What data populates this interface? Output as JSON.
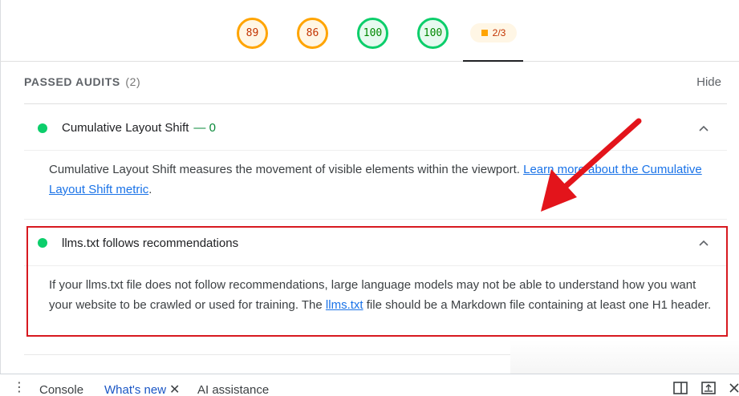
{
  "scores": {
    "performance": "89",
    "accessibility": "86",
    "best_practices": "100",
    "seo": "100",
    "pwa": "2/3"
  },
  "section": {
    "title": "PASSED AUDITS",
    "count": "(2)",
    "hide_label": "Hide"
  },
  "audits": [
    {
      "title": "Cumulative Layout Shift",
      "value": "— 0",
      "description": "Cumulative Layout Shift measures the movement of visible elements within the viewport. ",
      "link_text": "Learn more about the Cumulative Layout Shift metric",
      "description_end": "."
    },
    {
      "title": "llms.txt follows recommendations",
      "description": "If your llms.txt file does not follow recommendations, large language models may not be able to understand how you want your website to be crawled or used for training. The ",
      "link_text": "llms.txt",
      "description_end": " file should be a Markdown file containing at least one H1 header."
    }
  ],
  "drawer": {
    "tabs": [
      "Console",
      "What's new",
      "AI assistance"
    ],
    "active_tab": "What's new"
  },
  "colors": {
    "average": "#ffa400",
    "pass": "#0cce6b",
    "highlight": "#d71920",
    "link": "#1a73e8"
  }
}
